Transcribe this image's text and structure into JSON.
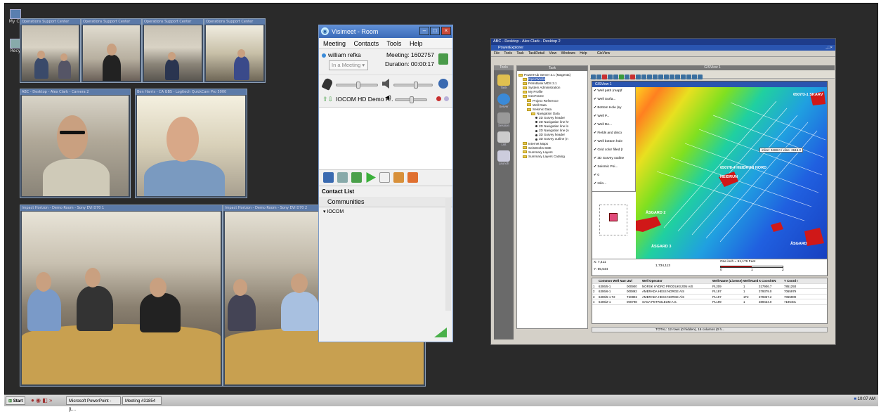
{
  "desktop": {
    "icons": [
      "My Co",
      "Recy",
      ""
    ]
  },
  "video_windows": {
    "top": [
      {
        "title": "Operations Support Center"
      },
      {
        "title": "Operations Support Center"
      },
      {
        "title": "Operations Support Center"
      },
      {
        "title": "Operations Support Center"
      }
    ],
    "mid_left": {
      "title": "ABC - Desktop - Alex Clark - Camera 2"
    },
    "mid_right": {
      "title": "Ben Harris - CA GBS - Logitech QuickCam Pro 5000"
    },
    "bottom_left": {
      "title": "Impact Horizon - Demo Room - Sony EVI D70 1"
    },
    "bottom_right": {
      "title": "Impact Horizon - Demo Room - Sony EVI D70 2"
    }
  },
  "visimeet": {
    "title": "Visimeet - Room",
    "menu": [
      "Meeting",
      "Contacts",
      "Tools",
      "Help"
    ],
    "user": "william refka",
    "status": "In a Meeting",
    "meeting_label": "Meeting: 1602757",
    "duration_label": "Duration: 00:00:17",
    "room_name": "IOCOM HD Demo R..",
    "contact_list_label": "Contact List",
    "communities_label": "Communities",
    "group_label": "IOCOM"
  },
  "powerexplorer": {
    "title": "ABC - Desktop - Alex Clark - Desktop 2",
    "app_title": "PowerExplorer",
    "menu": [
      "File",
      "Tools",
      "Task",
      "TaskDetail",
      "View",
      "Windows",
      "Help",
      "GisView"
    ],
    "panes": {
      "tools": "Tools",
      "task": "Task",
      "gis": "GISView 1"
    },
    "tool_labels": [
      "Task",
      "Server",
      "Session",
      "List",
      "Launch"
    ],
    "tree": [
      {
        "label": "PowerHub Server 3.1 (Magenta)",
        "type": "folder",
        "indent": 0
      },
      {
        "label": "OpenWorks",
        "type": "folder",
        "indent": 1
      },
      {
        "label": "PetroBank MDS 3.1",
        "type": "folder",
        "indent": 1
      },
      {
        "label": "System Administration",
        "type": "folder",
        "indent": 1
      },
      {
        "label": "My Profile",
        "type": "folder",
        "indent": 1
      },
      {
        "label": "GeoFrame",
        "type": "folder",
        "indent": 1
      },
      {
        "label": "Project Reference",
        "type": "folder",
        "indent": 2
      },
      {
        "label": "Well Data",
        "type": "folder",
        "indent": 2
      },
      {
        "label": "Seismic Data",
        "type": "folder",
        "indent": 2
      },
      {
        "label": "Navigation Data",
        "type": "folder",
        "indent": 3
      },
      {
        "label": "2D Survey header",
        "type": "dot",
        "indent": 4
      },
      {
        "label": "2D Navigation line hr",
        "type": "dot",
        "indent": 4
      },
      {
        "label": "2D Navigation line lo",
        "type": "dot",
        "indent": 4
      },
      {
        "label": "2D Navigation line (n",
        "type": "dot",
        "indent": 4
      },
      {
        "label": "3D Survey header",
        "type": "dot",
        "indent": 4
      },
      {
        "label": "3D Survey outline (n",
        "type": "dot",
        "indent": 4
      },
      {
        "label": "Internet Maps",
        "type": "folder",
        "indent": 1
      },
      {
        "label": "SeisWorks SDE",
        "type": "folder",
        "indent": 1
      },
      {
        "label": "Summary Layers",
        "type": "folder",
        "indent": 1
      },
      {
        "label": "Summary Layers Catalog",
        "type": "folder",
        "indent": 1
      }
    ],
    "gis_inner_title": "GISView 1",
    "layers": [
      "Well path (map)f",
      "Well Surfa...",
      "Bottom Hole (sy",
      "Well P...",
      "Well De...",
      "Fields and disco",
      "Well bottom hole",
      "Grid color filled (r",
      "3D Survey outline",
      "Seismic Poi...",
      "0",
      "Inlin..."
    ],
    "map_labels": [
      "ÅSGARD 2",
      "ÅSGARD 3",
      "HEIDRUN",
      "6507/8-4 HEIDRUN NORD",
      "ÅSGARD",
      "6507/3-1 SKARV"
    ],
    "map_info": "inline: 3468.0 / xline: 2615.0",
    "coords": {
      "x": "X: 7,411",
      "y": "Y: 65,544",
      "scale_val": "1,734,113",
      "scale_label": "One inch = 51,176 Feet",
      "ticks": [
        "0",
        "1",
        "2"
      ]
    },
    "table": {
      "headers": [
        "",
        "Common Well Name",
        "Uwi",
        "Well Operator",
        "Well Name (License)",
        "Well Number",
        "X Coord EN",
        "Y Coord I"
      ],
      "rows": [
        [
          "1",
          "6306/5-1",
          "000900",
          "NORSK HYDRO PRODUKSJON A/S",
          "PL209",
          "1",
          "317906.7",
          "7851293"
        ],
        [
          "2",
          "6306/6-1",
          "000892",
          "AMERADA HESS NORGE A/S",
          "PL197",
          "1",
          "379379.0",
          "7065979"
        ],
        [
          "3",
          "6306/5-1 T2",
          "T20892",
          "AMERADA HESS NORGE A/S",
          "PL197",
          "1T2",
          "379367.2",
          "7065909"
        ],
        [
          "4",
          "6406/2-1",
          "000798",
          "SAGA PETROLEUM A.S.",
          "PL199",
          "1",
          "389434.0",
          "7196401"
        ]
      ]
    },
    "status": "TOTAL: 12 rows (0 hidden), 16 columns (0 h..."
  },
  "taskbar": {
    "start": "Start",
    "items": [
      "Microsoft PowerPoint - [L...",
      "Meeting #31854"
    ],
    "clock": "10:07 AM"
  }
}
